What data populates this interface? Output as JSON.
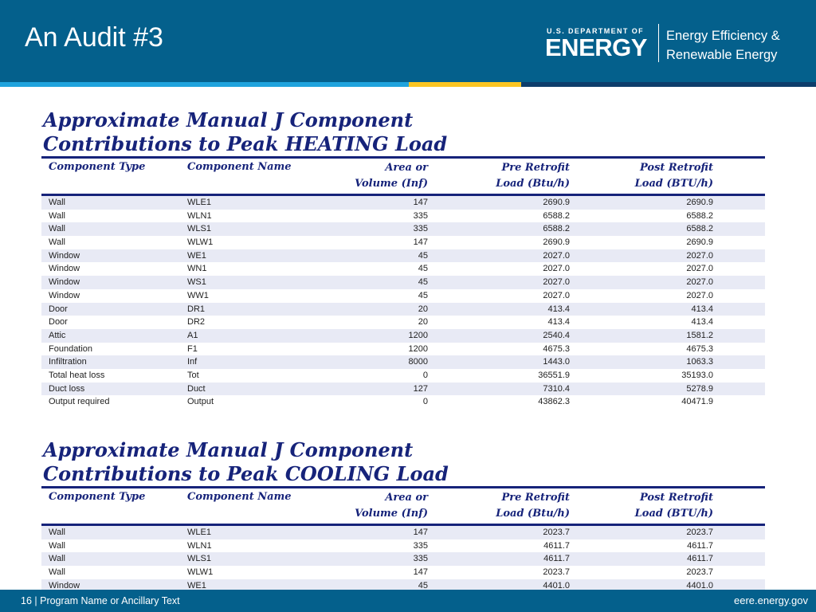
{
  "slide": {
    "title": "An Audit #3"
  },
  "logo": {
    "dept": "U.S. DEPARTMENT OF",
    "energy": "ENERGY",
    "line1": "Energy Efficiency &",
    "line2": "Renewable Energy"
  },
  "brand_colors": {
    "header": "#04608c",
    "stripe_blue": "#1fa3dd",
    "stripe_yellow": "#fbc522",
    "table_navy": "#16237a"
  },
  "columns": {
    "type": "Component Type",
    "name": "Component Name",
    "area_line1": "Area or",
    "area_line2": "Volume (Inf)",
    "pre_line1": "Pre Retrofit",
    "pre_line2": "Load (Btu/h)",
    "post_line1": "Post Retrofit",
    "post_line2": "Load (BTU/h)"
  },
  "heating": {
    "title_line1": "Approximate Manual J Component",
    "title_line2": "Contributions to Peak HEATING Load",
    "rows": [
      [
        "Wall",
        "WLE1",
        "147",
        "2690.9",
        "2690.9"
      ],
      [
        "Wall",
        "WLN1",
        "335",
        "6588.2",
        "6588.2"
      ],
      [
        "Wall",
        "WLS1",
        "335",
        "6588.2",
        "6588.2"
      ],
      [
        "Wall",
        "WLW1",
        "147",
        "2690.9",
        "2690.9"
      ],
      [
        "Window",
        "WE1",
        "45",
        "2027.0",
        "2027.0"
      ],
      [
        "Window",
        "WN1",
        "45",
        "2027.0",
        "2027.0"
      ],
      [
        "Window",
        "WS1",
        "45",
        "2027.0",
        "2027.0"
      ],
      [
        "Window",
        "WW1",
        "45",
        "2027.0",
        "2027.0"
      ],
      [
        "Door",
        "DR1",
        "20",
        "413.4",
        "413.4"
      ],
      [
        "Door",
        "DR2",
        "20",
        "413.4",
        "413.4"
      ],
      [
        "Attic",
        "A1",
        "1200",
        "2540.4",
        "1581.2"
      ],
      [
        "Foundation",
        "F1",
        "1200",
        "4675.3",
        "4675.3"
      ],
      [
        "Infiltration",
        "Inf",
        "8000",
        "1443.0",
        "1063.3"
      ],
      [
        "Total heat loss",
        "Tot",
        "0",
        "36551.9",
        "35193.0"
      ],
      [
        "Duct loss",
        "Duct",
        "127",
        "7310.4",
        "5278.9"
      ],
      [
        "Output required",
        "Output",
        "0",
        "43862.3",
        "40471.9"
      ]
    ]
  },
  "cooling": {
    "title_line1": "Approximate Manual J Component",
    "title_line2": "Contributions to Peak COOLING Load",
    "rows": [
      [
        "Wall",
        "WLE1",
        "147",
        "2023.7",
        "2023.7"
      ],
      [
        "Wall",
        "WLN1",
        "335",
        "4611.7",
        "4611.7"
      ],
      [
        "Wall",
        "WLS1",
        "335",
        "4611.7",
        "4611.7"
      ],
      [
        "Wall",
        "WLW1",
        "147",
        "2023.7",
        "2023.7"
      ],
      [
        "Window",
        "WE1",
        "45",
        "4401.0",
        "4401.0"
      ]
    ]
  },
  "footer": {
    "page_number": "16",
    "separator": " | ",
    "left_text": "Program Name or Ancillary Text",
    "right_text": "eere.energy.gov"
  }
}
